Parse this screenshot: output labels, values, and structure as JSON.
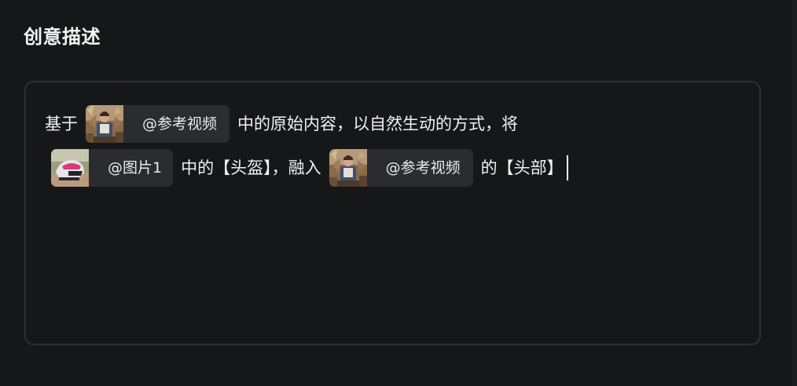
{
  "section": {
    "title": "创意描述"
  },
  "editor": {
    "line1": {
      "text_before": "基于",
      "chip_video_1": {
        "label": "@参考视频",
        "thumbnail_icon": "reference-video-thumbnail"
      },
      "text_after": "中的原始内容，以自然生动的方式，将"
    },
    "line2": {
      "chip_image_1": {
        "label": "@图片1",
        "thumbnail_icon": "helmet-image-thumbnail"
      },
      "text_middle": "中的【头盔】，融入",
      "chip_video_2": {
        "label": "@参考视频",
        "thumbnail_icon": "reference-video-thumbnail"
      },
      "text_end": "的【头部】"
    }
  },
  "colors": {
    "background": "#161719",
    "editor_border": "#2f3034",
    "chip_background": "#2b2c30",
    "text": "#f0f1f3"
  }
}
